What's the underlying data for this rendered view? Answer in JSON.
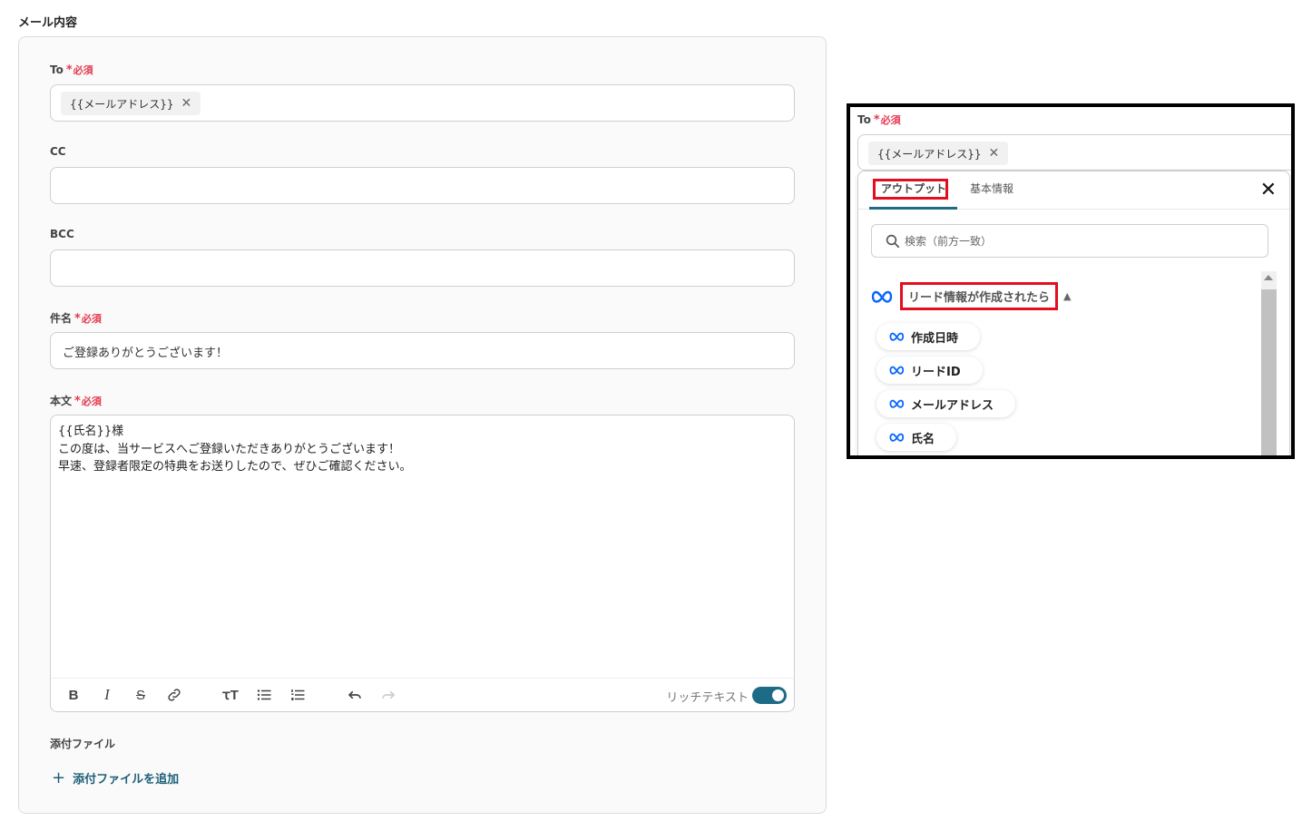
{
  "section_title": "メール内容",
  "required_label": "必須",
  "form": {
    "to": {
      "label": "To",
      "chip": "{{メールアドレス}}"
    },
    "cc": {
      "label": "CC",
      "value": ""
    },
    "bcc": {
      "label": "BCC",
      "value": ""
    },
    "subject": {
      "label": "件名",
      "value": "ご登録ありがとうございます！"
    },
    "body": {
      "label": "本文",
      "lines": [
        "{{氏名}}様",
        "",
        "この度は、当サービスへご登録いただきありがとうございます！",
        "",
        "早速、登録者限定の特典をお送りしたので、ぜひご確認ください。"
      ]
    },
    "toolbar": {
      "rich_text_label": "リッチテキスト",
      "rich_text_on": true
    },
    "attachments": {
      "label": "添付ファイル",
      "add_label": "添付ファイルを追加"
    }
  },
  "inset": {
    "to_label": "To",
    "chip": "{{メールアドレス}}",
    "tabs": [
      "アウトプット",
      "基本情報"
    ],
    "active_tab": "アウトプット",
    "search_placeholder": "検索（前方一致）",
    "group_title": "リード情報が作成されたら",
    "items": [
      "作成日時",
      "リードID",
      "メールアドレス",
      "氏名"
    ],
    "accent_color": "#1d6b86",
    "highlight_color": "#e10f1f",
    "meta_icon_color": "#0866ff"
  }
}
